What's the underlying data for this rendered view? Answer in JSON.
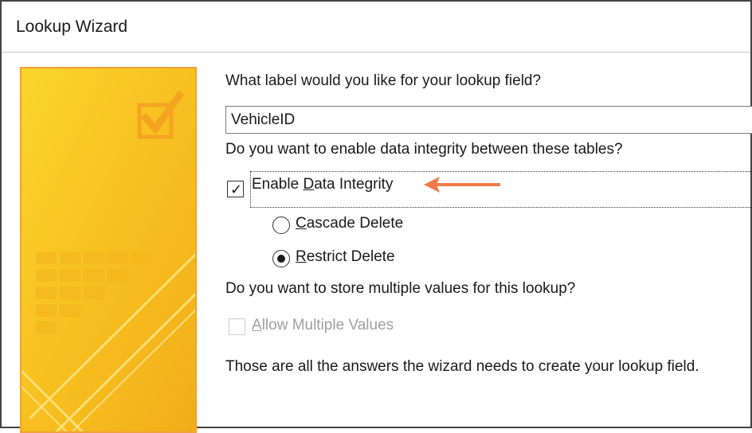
{
  "window": {
    "title": "Lookup Wizard"
  },
  "question_label": "What label would you like for your lookup field?",
  "label_field": {
    "value": "VehicleID"
  },
  "question_integrity": "Do you want to enable data integrity between these tables?",
  "enable_integrity": {
    "label_pre": "Enable ",
    "label_accel": "D",
    "label_post": "ata Integrity",
    "checked": true
  },
  "cascade_delete": {
    "label_accel": "C",
    "label_post": "ascade Delete",
    "selected": false
  },
  "restrict_delete": {
    "label_accel": "R",
    "label_post": "estrict Delete",
    "selected": true
  },
  "question_multiple": "Do you want to store multiple values for this lookup?",
  "allow_multiple": {
    "label_accel": "A",
    "label_post": "llow Multiple Values",
    "checked": false,
    "disabled": true
  },
  "final_message": "Those are all the answers the wizard needs to create your lookup field.",
  "annotation_arrow_color": "#f07a4a",
  "check_glyph": "✓",
  "colors": {
    "panel_border": "#f0a23c",
    "panel_yellow": "#f9c525"
  }
}
